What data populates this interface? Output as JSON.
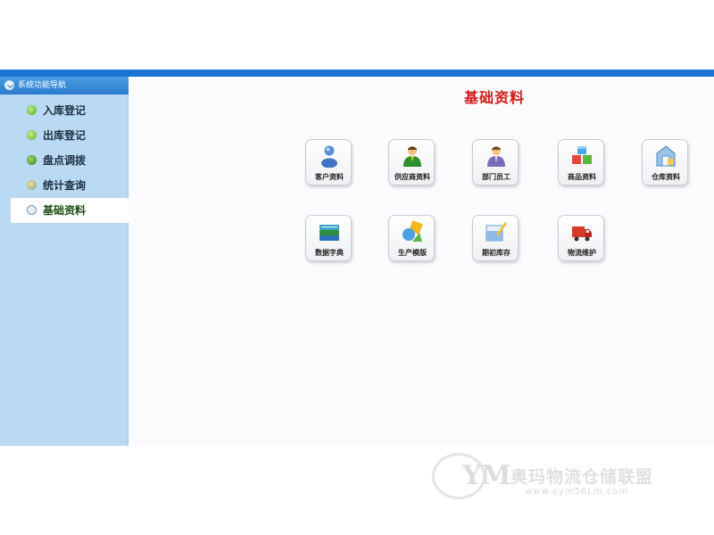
{
  "sidebar": {
    "header": "系统功能导航",
    "items": [
      {
        "label": "入库登记",
        "icon": "inbound-icon"
      },
      {
        "label": "出库登记",
        "icon": "outbound-icon"
      },
      {
        "label": "盘点调拨",
        "icon": "stocktake-icon"
      },
      {
        "label": "统计查询",
        "icon": "statistics-icon"
      },
      {
        "label": "基础资料",
        "icon": "base-data-icon",
        "active": true
      }
    ]
  },
  "main": {
    "title": "基础资料",
    "tiles": [
      {
        "label": "客户资料",
        "icon": "customer-icon"
      },
      {
        "label": "供应商资料",
        "icon": "supplier-icon"
      },
      {
        "label": "部门员工",
        "icon": "employee-icon"
      },
      {
        "label": "商品资料",
        "icon": "product-cubes-icon"
      },
      {
        "label": "仓库资料",
        "icon": "warehouse-icon"
      },
      {
        "label": "数据字典",
        "icon": "dictionary-books-icon"
      },
      {
        "label": "生产模版",
        "icon": "template-shapes-icon"
      },
      {
        "label": "期初库存",
        "icon": "opening-stock-icon"
      },
      {
        "label": "物流维护",
        "icon": "truck-icon"
      }
    ]
  },
  "watermark": {
    "logo": "YM",
    "text": "奥玛物流仓储联盟",
    "url": "www.oym56Lm.com"
  },
  "colors": {
    "topbar": "#1b74d1",
    "sidebar": "#b9daf2",
    "title": "#d11a1a"
  }
}
